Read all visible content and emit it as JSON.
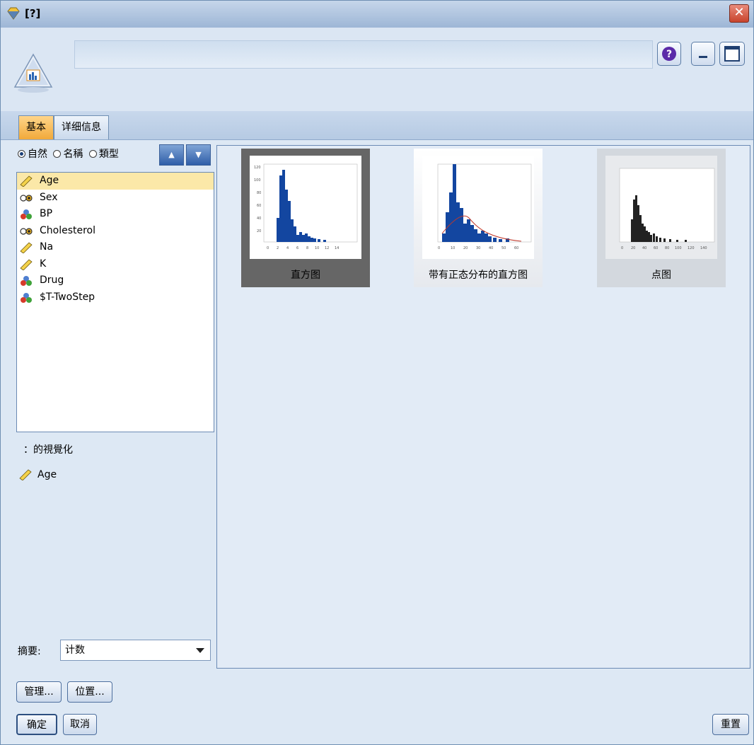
{
  "window": {
    "title": "[?]",
    "close_label": "✕"
  },
  "tabs": [
    {
      "label": "基本",
      "active": true
    },
    {
      "label": "详细信息",
      "active": false
    }
  ],
  "sort": {
    "options": [
      "自然",
      "名稱",
      "類型"
    ],
    "selected": "自然",
    "ascending_label": "▲",
    "descending_label": "▼"
  },
  "fields": [
    {
      "name": "Age",
      "icon": "continuous-ruler-icon",
      "selected": true
    },
    {
      "name": "Sex",
      "icon": "flag-icon",
      "selected": false
    },
    {
      "name": "BP",
      "icon": "nominal-set-icon",
      "selected": false
    },
    {
      "name": "Cholesterol",
      "icon": "flag-icon",
      "selected": false
    },
    {
      "name": "Na",
      "icon": "continuous-ruler-icon",
      "selected": false
    },
    {
      "name": "K",
      "icon": "continuous-ruler-icon",
      "selected": false
    },
    {
      "name": "Drug",
      "icon": "nominal-set-icon",
      "selected": false
    },
    {
      "name": "$T-TwoStep",
      "icon": "nominal-set-icon",
      "selected": false
    }
  ],
  "visualization": {
    "label": "：的視覺化",
    "field": "Age"
  },
  "summary": {
    "label": "摘要:",
    "value": "计数"
  },
  "gallery": [
    {
      "label": "直方图",
      "selected": true
    },
    {
      "label": "带有正态分布的直方图",
      "selected": false
    },
    {
      "label": "点图",
      "selected": false
    }
  ],
  "buttons": {
    "manage": "管理...",
    "location": "位置...",
    "ok": "确定",
    "cancel": "取消",
    "reset": "重置"
  },
  "colors": {
    "accent_tab": "#f1a93a",
    "bar_blue": "#1346a0",
    "selection": "#fbe8a8"
  }
}
